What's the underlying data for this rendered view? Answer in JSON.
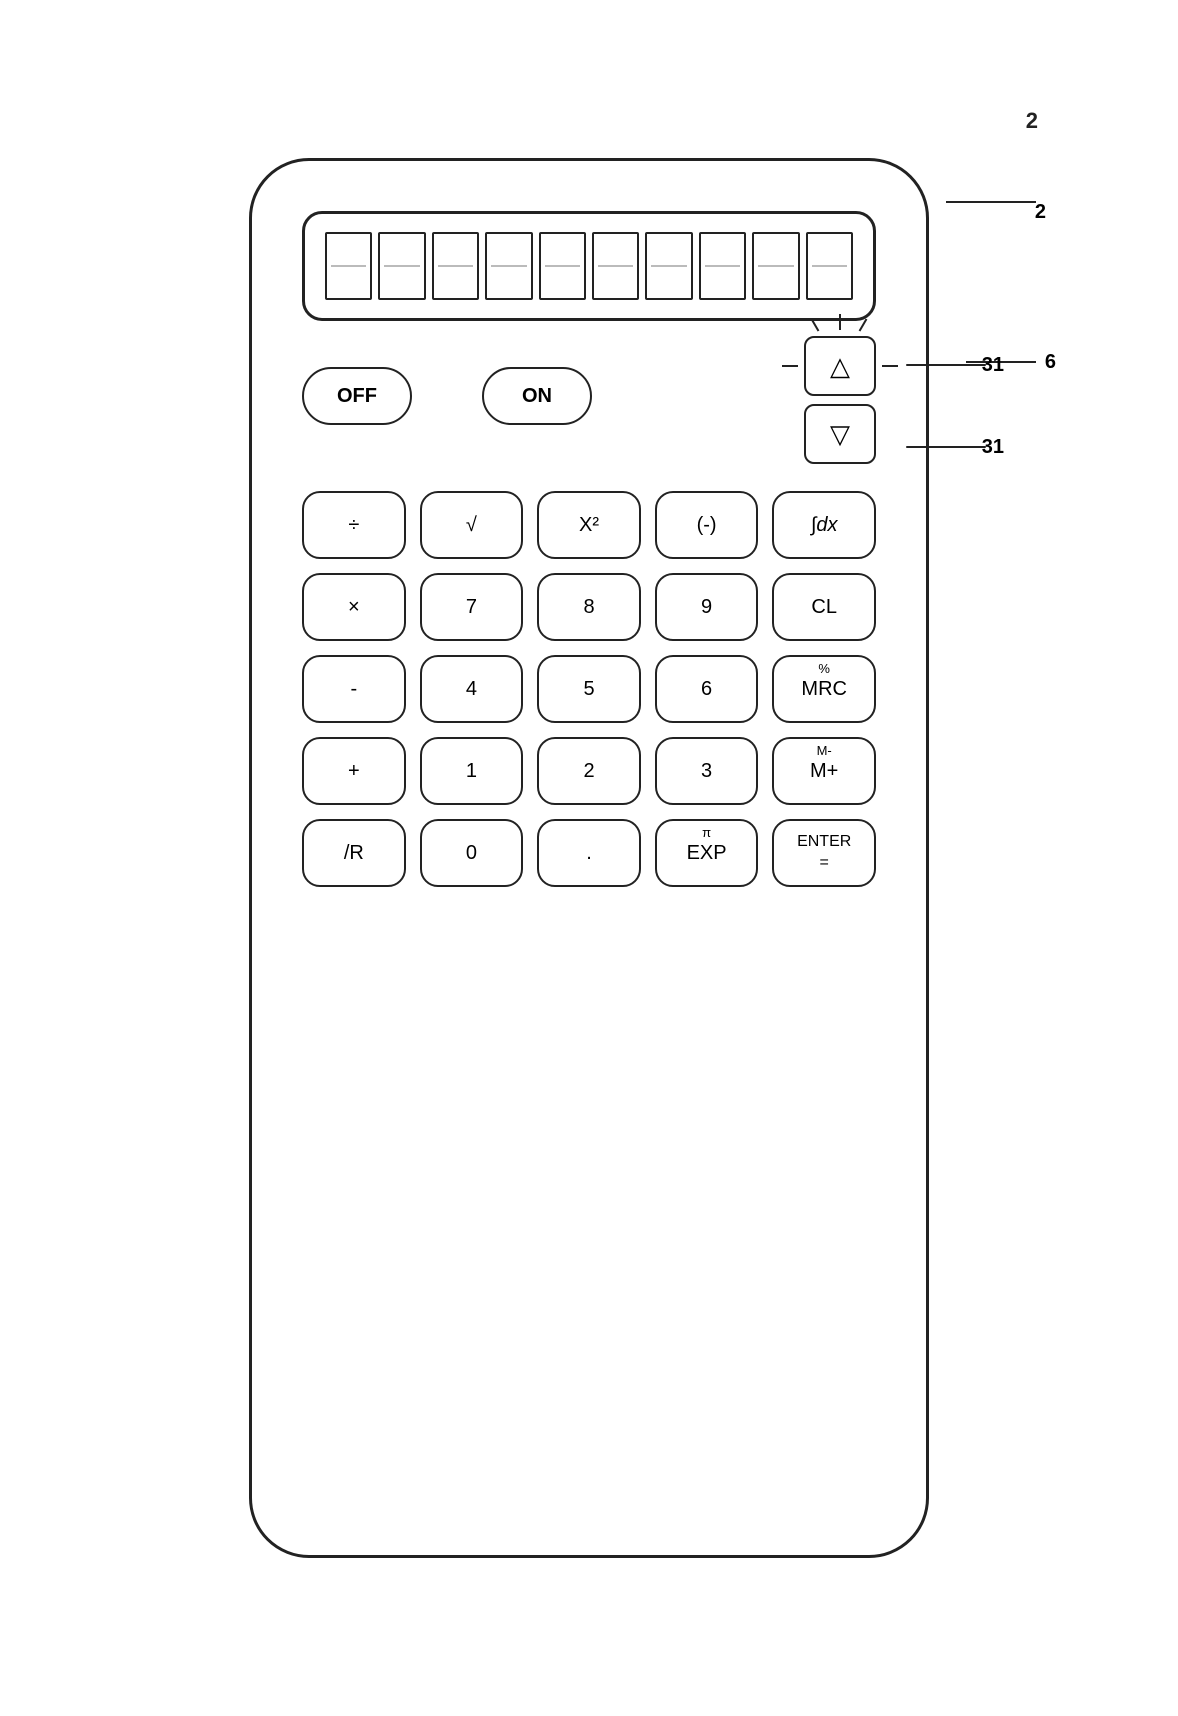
{
  "calculator": {
    "ref_main": "2",
    "ref_display": "6",
    "ref_arrow_up": "31",
    "ref_arrow_down": "31",
    "display": {
      "digits_count": 10
    },
    "power_buttons": [
      {
        "label": "OFF",
        "id": "off"
      },
      {
        "label": "ON",
        "id": "on"
      }
    ],
    "arrow_buttons": [
      {
        "label": "△",
        "id": "up",
        "glowing": true
      },
      {
        "label": "▽",
        "id": "down",
        "glowing": false
      }
    ],
    "keypad_rows": [
      [
        {
          "label": "÷",
          "secondary": "",
          "id": "divide"
        },
        {
          "label": "√",
          "secondary": "",
          "id": "sqrt"
        },
        {
          "label": "X²",
          "secondary": "",
          "id": "square"
        },
        {
          "label": "(-)",
          "secondary": "",
          "id": "negate"
        },
        {
          "label": "∫dx",
          "secondary": "",
          "id": "integral"
        }
      ],
      [
        {
          "label": "×",
          "secondary": "",
          "id": "multiply"
        },
        {
          "label": "7",
          "secondary": "",
          "id": "7"
        },
        {
          "label": "8",
          "secondary": "",
          "id": "8"
        },
        {
          "label": "9",
          "secondary": "",
          "id": "9"
        },
        {
          "label": "CL",
          "secondary": "",
          "id": "clear"
        }
      ],
      [
        {
          "label": "-",
          "secondary": "",
          "id": "subtract"
        },
        {
          "label": "4",
          "secondary": "",
          "id": "4"
        },
        {
          "label": "5",
          "secondary": "",
          "id": "5"
        },
        {
          "label": "6",
          "secondary": "",
          "id": "6"
        },
        {
          "label": "MRC",
          "secondary": "%",
          "id": "mrc"
        }
      ],
      [
        {
          "label": "+",
          "secondary": "",
          "id": "add"
        },
        {
          "label": "1",
          "secondary": "",
          "id": "1"
        },
        {
          "label": "2",
          "secondary": "",
          "id": "2"
        },
        {
          "label": "3",
          "secondary": "",
          "id": "3"
        },
        {
          "label": "M+",
          "secondary": "M-",
          "id": "mplus"
        }
      ],
      [
        {
          "label": "/R",
          "secondary": "",
          "id": "rootr"
        },
        {
          "label": "0",
          "secondary": "",
          "id": "0"
        },
        {
          "label": ".",
          "secondary": "",
          "id": "decimal"
        },
        {
          "label": "EXP",
          "secondary": "π",
          "id": "exp"
        },
        {
          "label": "ENTER =",
          "secondary": "",
          "id": "enter"
        }
      ]
    ]
  }
}
